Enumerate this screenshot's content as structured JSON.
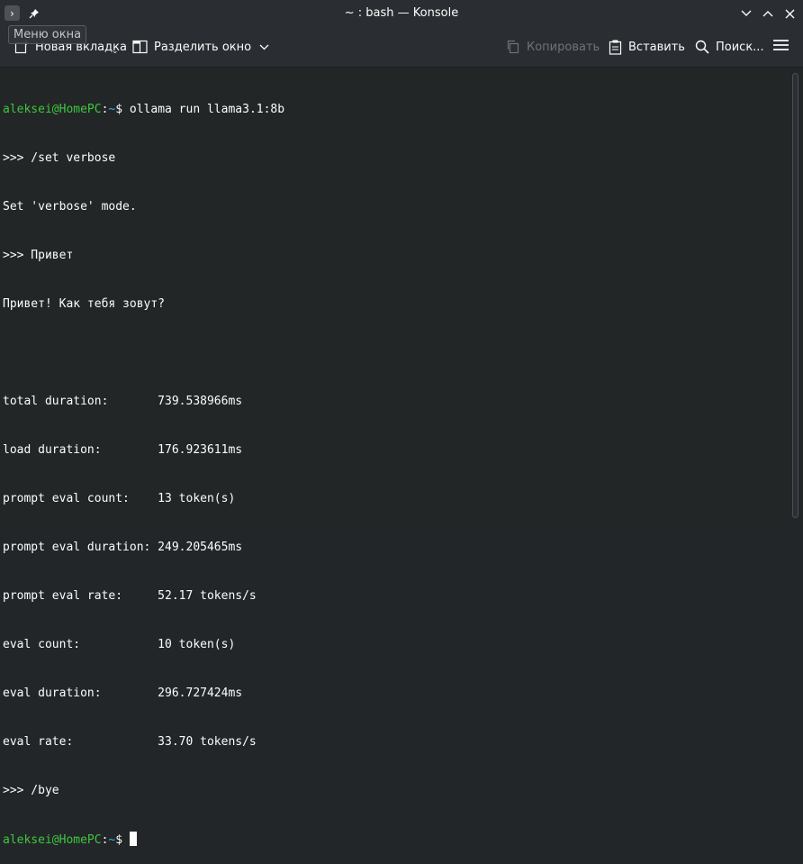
{
  "window": {
    "title": "~ : bash — Konsole",
    "menu_tooltip": "Меню окна"
  },
  "toolbar": {
    "new_tab": "Новая вкладка",
    "split_view": "Разделить окно",
    "copy": "Копировать",
    "paste": "Вставить",
    "search": "Поиск..."
  },
  "terminal": {
    "prompt_user": "aleksei@HomePC",
    "prompt_path": "~",
    "command": "ollama run llama3.1:8b",
    "lines": [
      ">>> /set verbose",
      "Set 'verbose' mode.",
      ">>> Привет",
      "Привет! Как тебя зовут?",
      "",
      "total duration:       739.538966ms",
      "load duration:        176.923611ms",
      "prompt eval count:    13 token(s)",
      "prompt eval duration: 249.205465ms",
      "prompt eval rate:     52.17 tokens/s",
      "eval count:           10 token(s)",
      "eval duration:        296.727424ms",
      "eval rate:            33.70 tokens/s",
      ">>> /bye"
    ]
  },
  "colors": {
    "prompt_user": "#3ec63e",
    "prompt_path": "#3daee9",
    "background": "#232627"
  }
}
